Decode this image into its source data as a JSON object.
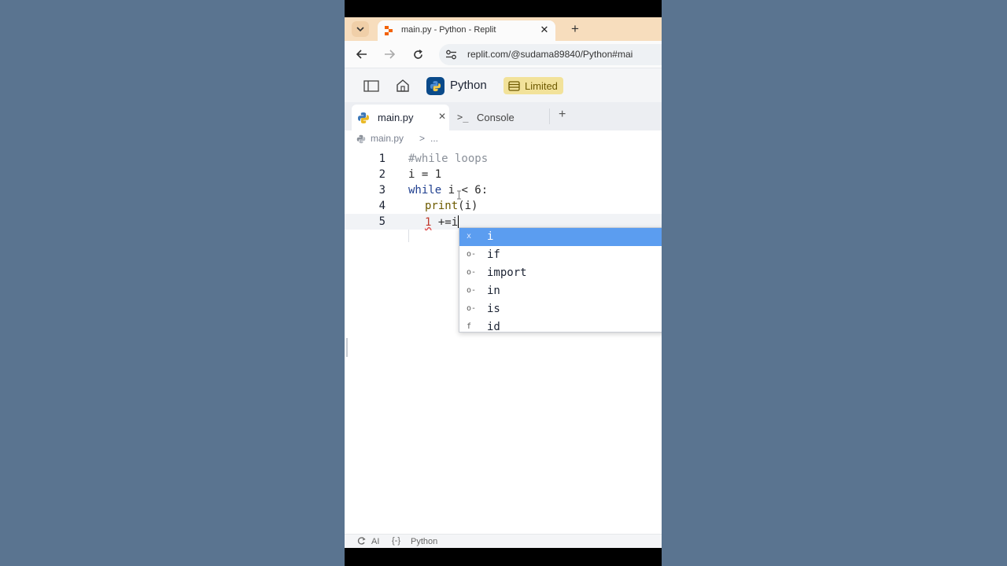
{
  "browser": {
    "tab_title": "main.py - Python - Replit",
    "tab_close": "✕",
    "new_tab": "+",
    "url": "replit.com/@sudama89840/Python#mai"
  },
  "replit": {
    "repl_name": "Python",
    "plan_badge": "Limited"
  },
  "editor_tabs": {
    "main_tab": "main.py",
    "main_close": "✕",
    "console_icon": ">_",
    "console_tab": "Console",
    "add": "+"
  },
  "breadcrumb": {
    "file": "main.py",
    "sep": ">",
    "more": "..."
  },
  "code": {
    "line_numbers": [
      "1",
      "2",
      "3",
      "4",
      "5"
    ],
    "line1": "#while loops",
    "line2": "i = 1",
    "line3_kw": "while",
    "line3_rest": " i < 6:",
    "line4_fn": "print",
    "line4_rest": "(i)",
    "line5_err": "1",
    "line5_rest": " +=i"
  },
  "autocomplete": {
    "items": [
      {
        "icon": "x",
        "label": "i"
      },
      {
        "icon": "o-",
        "label": "if"
      },
      {
        "icon": "o-",
        "label": "import"
      },
      {
        "icon": "o-",
        "label": "in"
      },
      {
        "icon": "o-",
        "label": "is"
      },
      {
        "icon": "f",
        "label": "id"
      }
    ]
  },
  "statusbar": {
    "ai": "AI",
    "lang_icon": "{-}",
    "lang": "Python"
  },
  "colors": {
    "tab_strip": "#f7ddbd",
    "selection": "#5b9df0",
    "badge": "#f2e29a"
  }
}
